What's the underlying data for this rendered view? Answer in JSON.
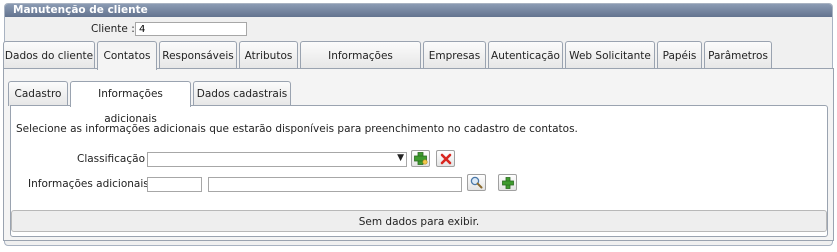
{
  "panel": {
    "title": "Manutenção de cliente"
  },
  "cliente": {
    "label": "Cliente :",
    "value": "4"
  },
  "tabs": [
    {
      "label": "Dados do cliente"
    },
    {
      "label": "Contatos"
    },
    {
      "label": "Responsáveis"
    },
    {
      "label": "Atributos"
    },
    {
      "label": "Informações adicionais"
    },
    {
      "label": "Empresas"
    },
    {
      "label": "Autenticação"
    },
    {
      "label": "Web Solicitante"
    },
    {
      "label": "Papéis"
    },
    {
      "label": "Parâmetros"
    }
  ],
  "active_tab": "Contatos",
  "subtabs": [
    {
      "label": "Cadastro"
    },
    {
      "label": "Informações adicionais"
    },
    {
      "label": "Dados cadastrais"
    }
  ],
  "active_subtab": "Informações adicionais",
  "content": {
    "description": "Selecione as informações adicionais que estarão disponíveis para preenchimento no cadastro de contatos.",
    "classificacao_label": "Classificação :",
    "classificacao_value": "",
    "info_label": "Informações adicionais :",
    "empty_text": "Sem dados para exibir."
  },
  "icons": {
    "add": "add-icon",
    "delete": "delete-icon",
    "search": "search-icon",
    "plus": "plus-icon"
  },
  "colors": {
    "header_gradient_top": "#8b9bb3",
    "header_gradient_bottom": "#63738f",
    "add_green": "#3e9b2e",
    "delete_red": "#d8261f"
  }
}
